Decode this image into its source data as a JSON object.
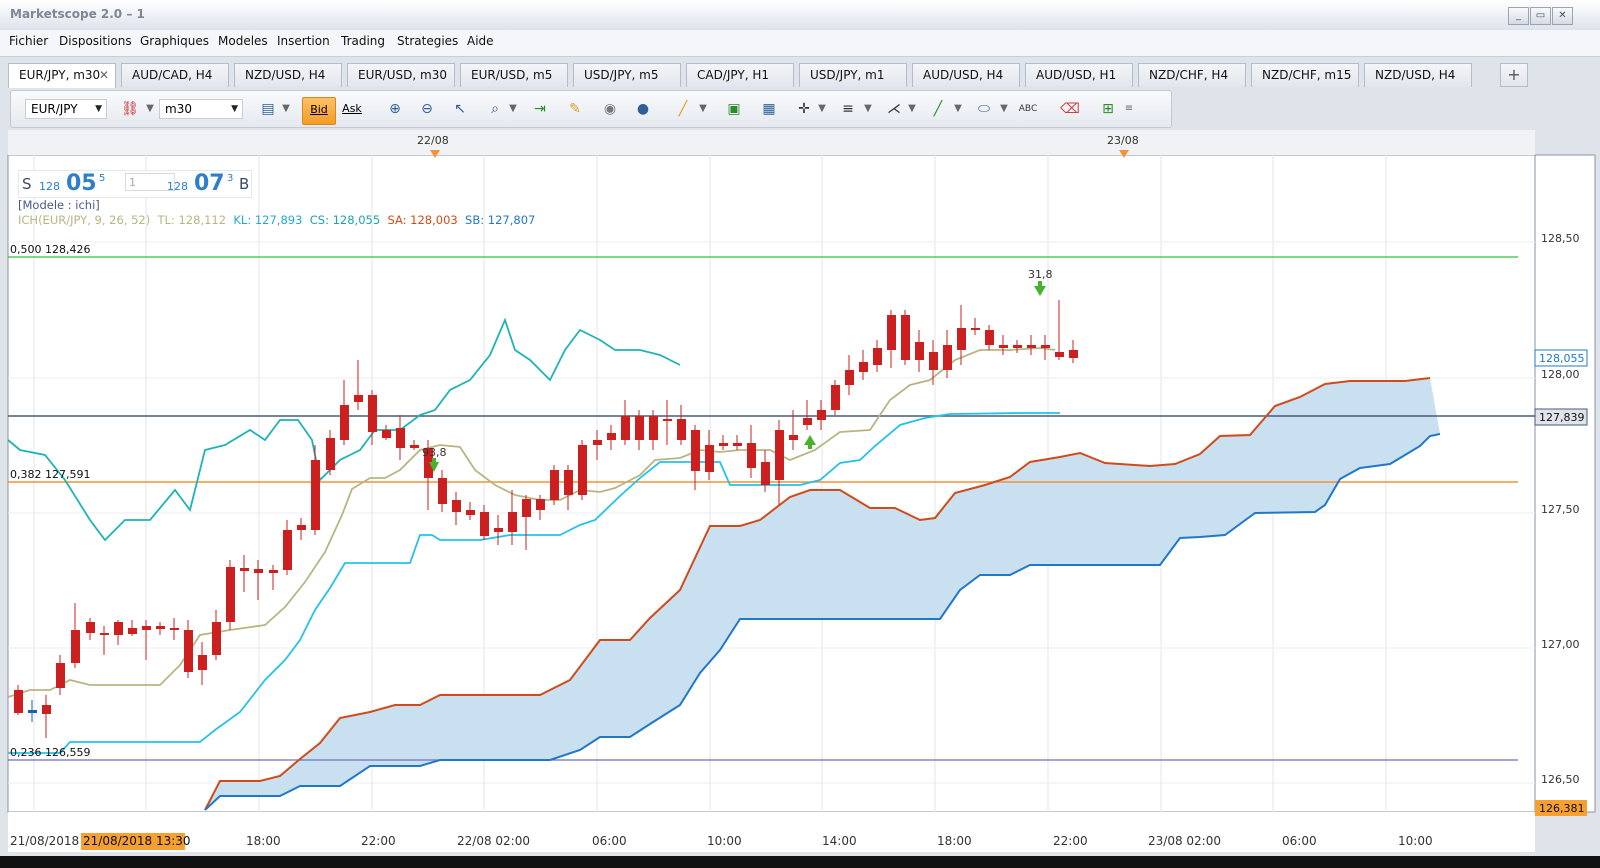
{
  "window": {
    "title": "Marketscope 2.0 – 1",
    "min": "_",
    "max": "▭",
    "close": "✕"
  },
  "menu": [
    "Fichier",
    "Dispositions",
    "Graphiques",
    "Modeles",
    "Insertion",
    "Trading",
    "Strategies",
    "Aide"
  ],
  "tabs": [
    {
      "label": "EUR/JPY, m30",
      "active": true,
      "close": "✕"
    },
    {
      "label": "AUD/CAD, H4"
    },
    {
      "label": "NZD/USD, H4"
    },
    {
      "label": "EUR/USD, m30"
    },
    {
      "label": "EUR/USD, m5"
    },
    {
      "label": "USD/JPY, m5"
    },
    {
      "label": "CAD/JPY, H1"
    },
    {
      "label": "USD/JPY, m1"
    },
    {
      "label": "AUD/USD, H4"
    },
    {
      "label": "AUD/USD, H1"
    },
    {
      "label": "NZD/CHF, H4"
    },
    {
      "label": "NZD/CHF, m15"
    },
    {
      "label": "NZD/USD, H4"
    }
  ],
  "tab_add": "+",
  "toolbar": {
    "instrument": "EUR/JPY",
    "timeframe": "m30",
    "bid_label": "Bid",
    "ask_label": "Ask"
  },
  "quote": {
    "sell_label": "S",
    "buy_label": "B",
    "sell_small": "128",
    "sell_big": "05",
    "sell_sup": "5",
    "buy_small": "128",
    "buy_big": "07",
    "buy_sup": "3",
    "amount": "1"
  },
  "legend": {
    "model": "[Modele : ichi]",
    "ich": "ICH(EUR/JPY, 9, 26, 52)",
    "tl": "TL: 128,112",
    "kl": "KL: 127,893",
    "cs": "CS: 128,055",
    "sa": "SA: 128,003",
    "sb": "SB: 127,807"
  },
  "fib_labels": [
    "0,500 128,426",
    "0,382 127,591",
    "0,236 126,559"
  ],
  "price_labels": {
    "ticks": [
      "128,50",
      "128,00",
      "127,50",
      "127,00",
      "126,50"
    ],
    "current": "128,055",
    "line": "127,839",
    "low": "126,381"
  },
  "top_dates": [
    "22/08",
    "23/08"
  ],
  "time_labels": [
    "21/08/2018",
    "21/08/2018 13:30",
    "18:00",
    "22:00",
    "22/08 02:00",
    "06:00",
    "10:00",
    "14:00",
    "18:00",
    "22:00",
    "23/08 02:00",
    "06:00",
    "10:00"
  ],
  "markers": [
    "93,8",
    "31,8"
  ],
  "colors": {
    "bull": "#1a5fb4",
    "bear": "#cc1f1f",
    "tenkan": "#b8b583",
    "kijun": "#23c3e8",
    "chikou": "#1fb3b3",
    "senkou_a": "#d14a1a",
    "senkou_b": "#2278c8",
    "cloud": "#c8e0f0",
    "fib_500": "#35c235",
    "fib_382": "#f39238",
    "fib_236": "#6f6fb8"
  }
}
